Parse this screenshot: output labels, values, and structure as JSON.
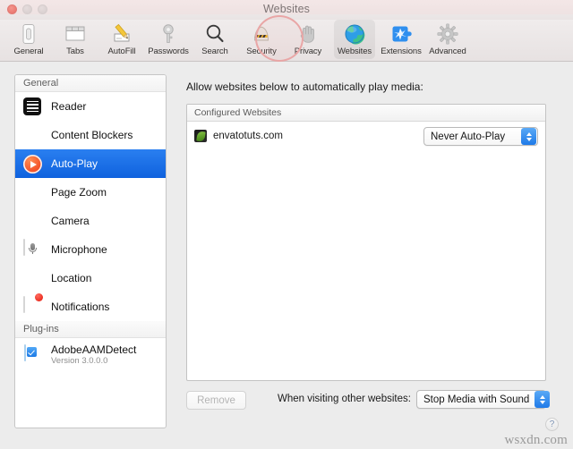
{
  "window": {
    "title": "Websites",
    "traffic_lights": [
      "close",
      "minimize",
      "zoom"
    ]
  },
  "toolbar": {
    "items": [
      {
        "label": "General",
        "icon": "general-icon"
      },
      {
        "label": "Tabs",
        "icon": "tabs-icon"
      },
      {
        "label": "AutoFill",
        "icon": "autofill-pencil-icon"
      },
      {
        "label": "Passwords",
        "icon": "key-icon"
      },
      {
        "label": "Search",
        "icon": "magnifier-icon"
      },
      {
        "label": "Security",
        "icon": "security-lock-icon"
      },
      {
        "label": "Privacy",
        "icon": "privacy-hand-icon"
      },
      {
        "label": "Websites",
        "icon": "globe-icon"
      },
      {
        "label": "Extensions",
        "icon": "extensions-puzzle-icon"
      },
      {
        "label": "Advanced",
        "icon": "gear-icon"
      }
    ],
    "selected": "Websites",
    "highlight_color": "#e9a6a6"
  },
  "sidebar": {
    "group_general": {
      "header": "General",
      "items": [
        {
          "label": "Reader",
          "icon": "reader-icon"
        },
        {
          "label": "Content Blockers",
          "icon": "content-blockers-icon"
        },
        {
          "label": "Auto-Play",
          "icon": "auto-play-icon"
        },
        {
          "label": "Page Zoom",
          "icon": "page-zoom-icon"
        },
        {
          "label": "Camera",
          "icon": "camera-icon"
        },
        {
          "label": "Microphone",
          "icon": "microphone-icon"
        },
        {
          "label": "Location",
          "icon": "location-icon"
        },
        {
          "label": "Notifications",
          "icon": "notifications-icon"
        }
      ],
      "selected": "Auto-Play",
      "selected_color": "#1f6feb"
    },
    "group_plugins": {
      "header": "Plug-ins",
      "items": [
        {
          "label": "AdobeAAMDetect",
          "sublabel": "Version 3.0.0.0",
          "icon": "plugin-checkbox-icon",
          "checked": true
        }
      ]
    }
  },
  "main": {
    "caption": "Allow websites below to automatically play media:",
    "table": {
      "column_header": "Configured Websites",
      "rows": [
        {
          "site": "envatotuts.com",
          "favicon": "envato-leaf-favicon",
          "setting": "Never Auto-Play"
        }
      ]
    },
    "footer": {
      "remove_label": "Remove",
      "remove_disabled": true,
      "other_label": "When visiting other websites:",
      "other_value": "Stop Media with Sound"
    }
  },
  "help": {
    "label": "?"
  },
  "watermark": {
    "text": "wsxdn.com"
  }
}
